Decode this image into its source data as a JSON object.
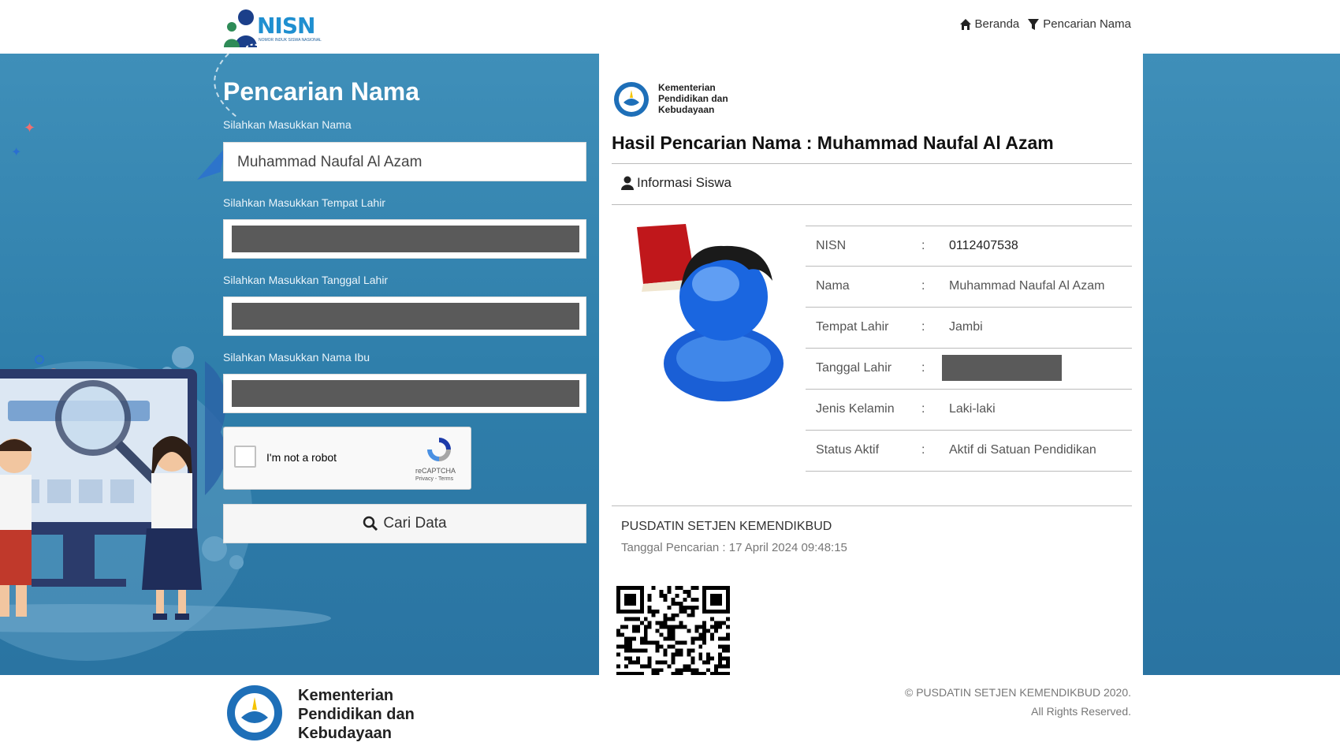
{
  "header": {
    "logo_text": "NISN",
    "logo_subtitle": "NOMOR INDUK SISWA NASIONAL",
    "nav": [
      {
        "label": "Beranda",
        "icon": "home-icon"
      },
      {
        "label": "Pencarian Nama",
        "icon": "filter-icon"
      }
    ]
  },
  "form": {
    "title": "Pencarian Nama",
    "name_label": "Silahkan Masukkan Nama",
    "name_value": "Muhammad Naufal Al Azam",
    "birthplace_label": "Silahkan Masukkan Tempat Lahir",
    "birthdate_label": "Silahkan Masukkan Tanggal Lahir",
    "mother_label": "Silahkan Masukkan Nama Ibu",
    "captcha_text": "I'm not a robot",
    "captcha_brand": "reCAPTCHA",
    "captcha_links": "Privacy - Terms",
    "search_button": "Cari Data"
  },
  "result": {
    "ministry": "Kementerian Pendidikan dan Kebudayaan",
    "title": "Hasil Pencarian Nama : Muhammad Naufal Al Azam",
    "section": "Informasi Siswa",
    "rows": [
      {
        "key": "NISN",
        "value": "0112407538"
      },
      {
        "key": "Nama",
        "value": "Muhammad Naufal Al Azam"
      },
      {
        "key": "Tempat Lahir",
        "value": "Jambi"
      },
      {
        "key": "Tanggal Lahir",
        "value": ""
      },
      {
        "key": "Jenis Kelamin",
        "value": "Laki-laki"
      },
      {
        "key": "Status Aktif",
        "value": "Aktif di Satuan Pendidikan"
      }
    ],
    "separator": ":",
    "source": "PUSDATIN SETJEN KEMENDIKBUD",
    "search_date": "Tanggal Pencarian : 17 April 2024 09:48:15"
  },
  "footer": {
    "ministry_line1": "Kementerian",
    "ministry_line2": "Pendidikan dan",
    "ministry_line3": "Kebudayaan",
    "copyright": "© PUSDATIN SETJEN KEMENDIKBUD 2020.",
    "rights": "All Rights Reserved."
  },
  "colors": {
    "bg_blue": "#2f7fab",
    "logo_blue": "#1f8fd0",
    "redaction": "#5a5a5a"
  }
}
